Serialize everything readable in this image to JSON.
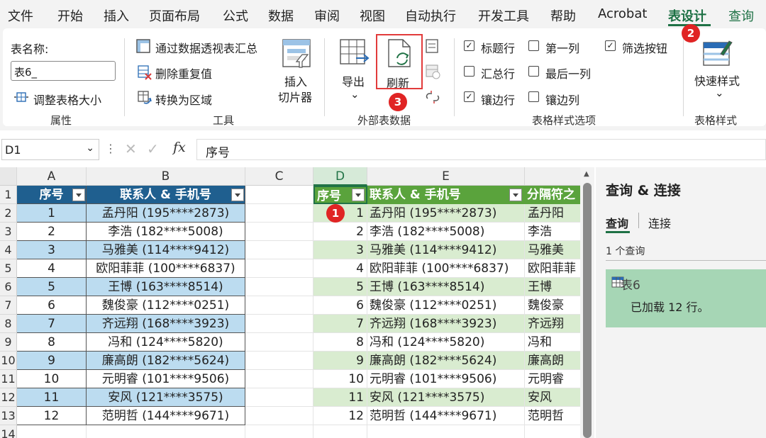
{
  "menu": {
    "items": [
      "文件",
      "开始",
      "插入",
      "页面布局",
      "公式",
      "数据",
      "审阅",
      "视图",
      "自动执行",
      "开发工具",
      "帮助",
      "Acrobat",
      "表设计",
      "查询"
    ],
    "active": "表设计"
  },
  "ribbon": {
    "properties": {
      "name_label": "表名称:",
      "name_value": "表6_",
      "resize": "调整表格大小",
      "group": "属性"
    },
    "tools": {
      "pivot": "通过数据透视表汇总",
      "dedupe": "删除重复值",
      "to_range": "转换为区域",
      "slicer_line1": "插入",
      "slicer_line2": "切片器",
      "group": "工具"
    },
    "external": {
      "export": "导出",
      "refresh": "刷新",
      "group": "外部表数据"
    },
    "style_options": {
      "header_row": "标题行",
      "total_row": "汇总行",
      "banded_rows": "镶边行",
      "first_col": "第一列",
      "last_col": "最后一列",
      "banded_cols": "镶边列",
      "filter_btn": "筛选按钮",
      "group": "表格样式选项"
    },
    "styles": {
      "quick": "快速样式",
      "group": "表格样式"
    }
  },
  "formula_bar": {
    "name_box": "D1",
    "fx": "fx",
    "content": "序号"
  },
  "badges": [
    "1",
    "2",
    "3"
  ],
  "columns": [
    "A",
    "B",
    "C",
    "D",
    "E"
  ],
  "row_numbers": [
    "1",
    "2",
    "3",
    "4",
    "5",
    "6",
    "7",
    "8",
    "9",
    "10",
    "11",
    "12",
    "13",
    "14"
  ],
  "table1": {
    "headers": [
      "序号",
      "联系人 & 手机号"
    ],
    "rows": [
      [
        "1",
        "孟丹阳 (195****2873)"
      ],
      [
        "2",
        "李浩 (182****5008)"
      ],
      [
        "3",
        "马雅美 (114****9412)"
      ],
      [
        "4",
        "欧阳菲菲 (100****6837)"
      ],
      [
        "5",
        "王博 (163****8514)"
      ],
      [
        "6",
        "魏俊豪 (112****0251)"
      ],
      [
        "7",
        "齐远翔 (168****3923)"
      ],
      [
        "8",
        "冯和 (124****5820)"
      ],
      [
        "9",
        "廉高朗 (182****5624)"
      ],
      [
        "10",
        "元明睿 (101****9506)"
      ],
      [
        "11",
        "安风 (121****3575)"
      ],
      [
        "12",
        "范明哲 (144****9671)"
      ]
    ]
  },
  "table2": {
    "headers": [
      "序号",
      "联系人 & 手机号",
      "分隔符之"
    ],
    "rows": [
      [
        "1",
        "孟丹阳 (195****2873)",
        "孟丹阳"
      ],
      [
        "2",
        "李浩 (182****5008)",
        "李浩"
      ],
      [
        "3",
        "马雅美 (114****9412)",
        "马雅美"
      ],
      [
        "4",
        "欧阳菲菲 (100****6837)",
        "欧阳菲菲"
      ],
      [
        "5",
        "王博 (163****8514)",
        "王博"
      ],
      [
        "6",
        "魏俊豪 (112****0251)",
        "魏俊豪"
      ],
      [
        "7",
        "齐远翔 (168****3923)",
        "齐远翔"
      ],
      [
        "8",
        "冯和 (124****5820)",
        "冯和"
      ],
      [
        "9",
        "廉高朗 (182****5624)",
        "廉高朗"
      ],
      [
        "10",
        "元明睿 (101****9506)",
        "元明睿"
      ],
      [
        "11",
        "安风 (121****3575)",
        "安风"
      ],
      [
        "12",
        "范明哲 (144****9671)",
        "范明哲"
      ]
    ]
  },
  "query_panel": {
    "title": "查询 & 连接",
    "tab_queries": "查询",
    "tab_connections": "连接",
    "count": "1 个查询",
    "query_name": "表6",
    "query_status": "已加载 12 行。"
  },
  "colors": {
    "accent": "#1e7145",
    "table1_header": "#1f5f8f",
    "table2_header": "#5aa33c",
    "badge": "#e02424"
  }
}
